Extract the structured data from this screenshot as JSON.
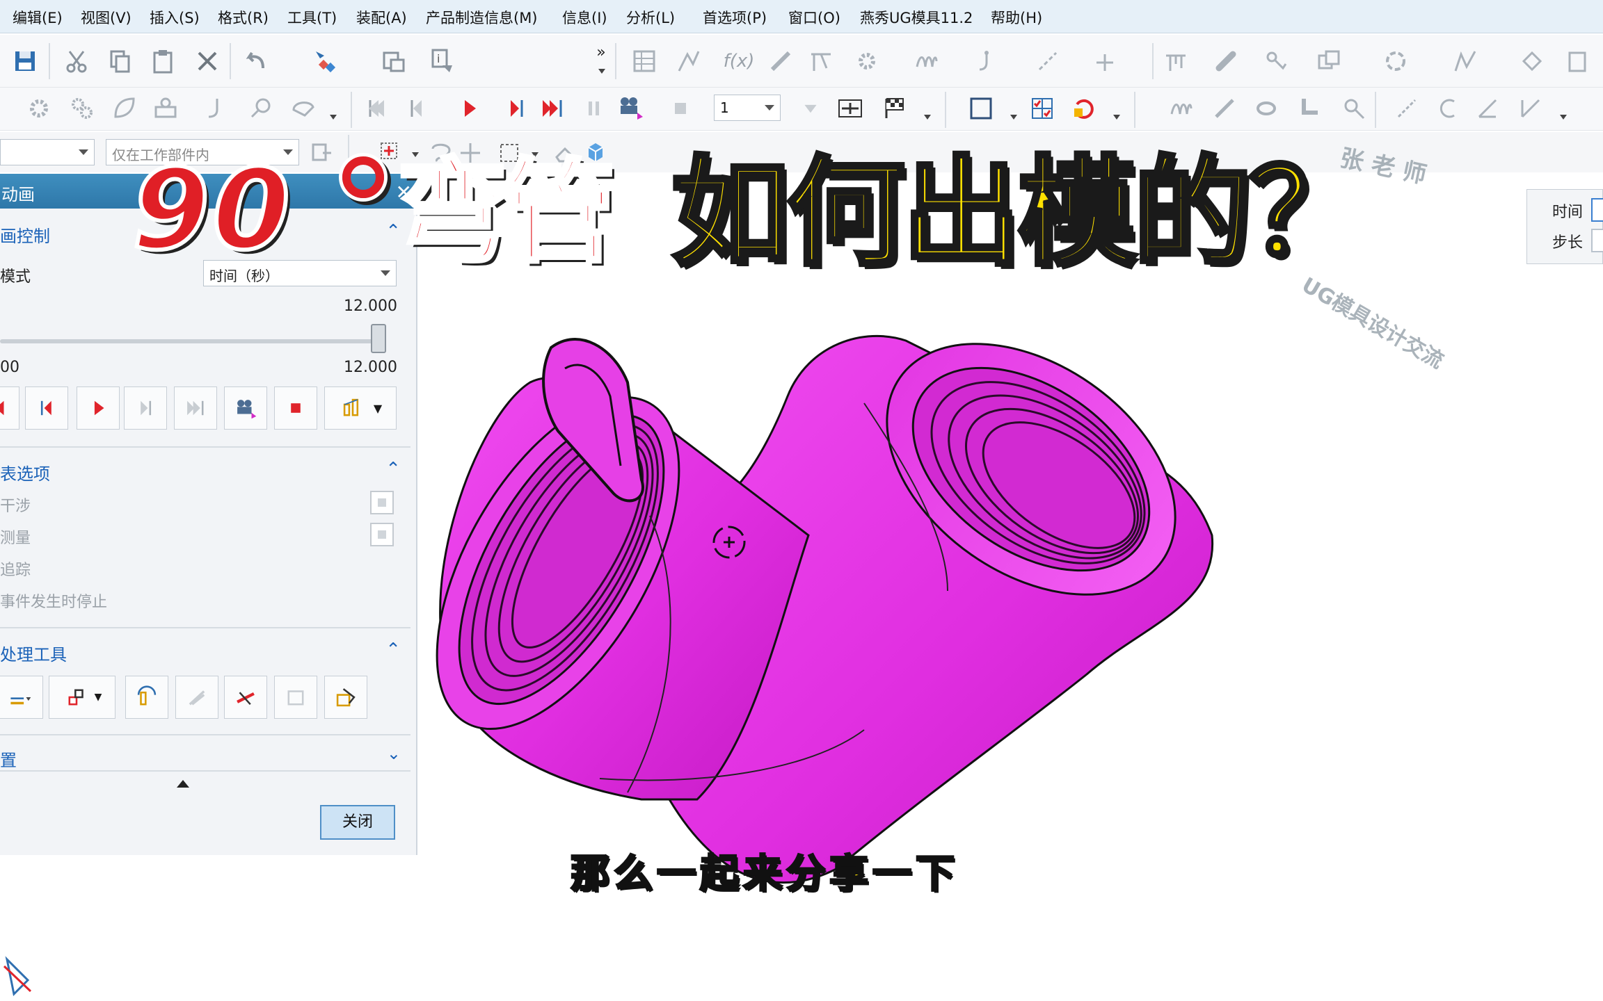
{
  "menu": [
    "编辑(E)",
    "视图(V)",
    "插入(S)",
    "格式(R)",
    "工具(T)",
    "装配(A)",
    "产品制造信息(M)",
    "信息(I)",
    "分析(L)",
    "首选项(P)",
    "窗口(O)",
    "燕秀UG模具11.2",
    "帮助(H)"
  ],
  "toolbar": {
    "step_value": "1",
    "filter_placeholder": "仅在工作部件内"
  },
  "panel": {
    "title": "动画",
    "section_control": "画控制",
    "mode_label": "模式",
    "mode_value": "时间（秒）",
    "slider_max_top": "12.000",
    "slider_min": "00",
    "slider_max": "12.000",
    "slider_fraction": 1.0,
    "section_options": "表选项",
    "opt_interference": "干涉",
    "opt_measure": "测量",
    "opt_trace": "追踪",
    "opt_stop": "事件发生时停止",
    "section_tools": "处理工具",
    "section_settings": "置",
    "close_label": "关闭"
  },
  "timebox": {
    "time_label": "时间",
    "step_label": "步长"
  },
  "overlay": {
    "num": "90",
    "wan": "弯管",
    "question": "如何出模的？",
    "subtitle": "那么一起来分享一下"
  },
  "watermark": {
    "top": "张 老 师",
    "ring": "UG模具设计交流"
  },
  "colors": {
    "model": "#e333e3",
    "accent_red": "#e01f26",
    "accent_yellow": "#ffe100",
    "panel_title": "#2e77a9",
    "menu_bg": "#e6f0f8"
  }
}
